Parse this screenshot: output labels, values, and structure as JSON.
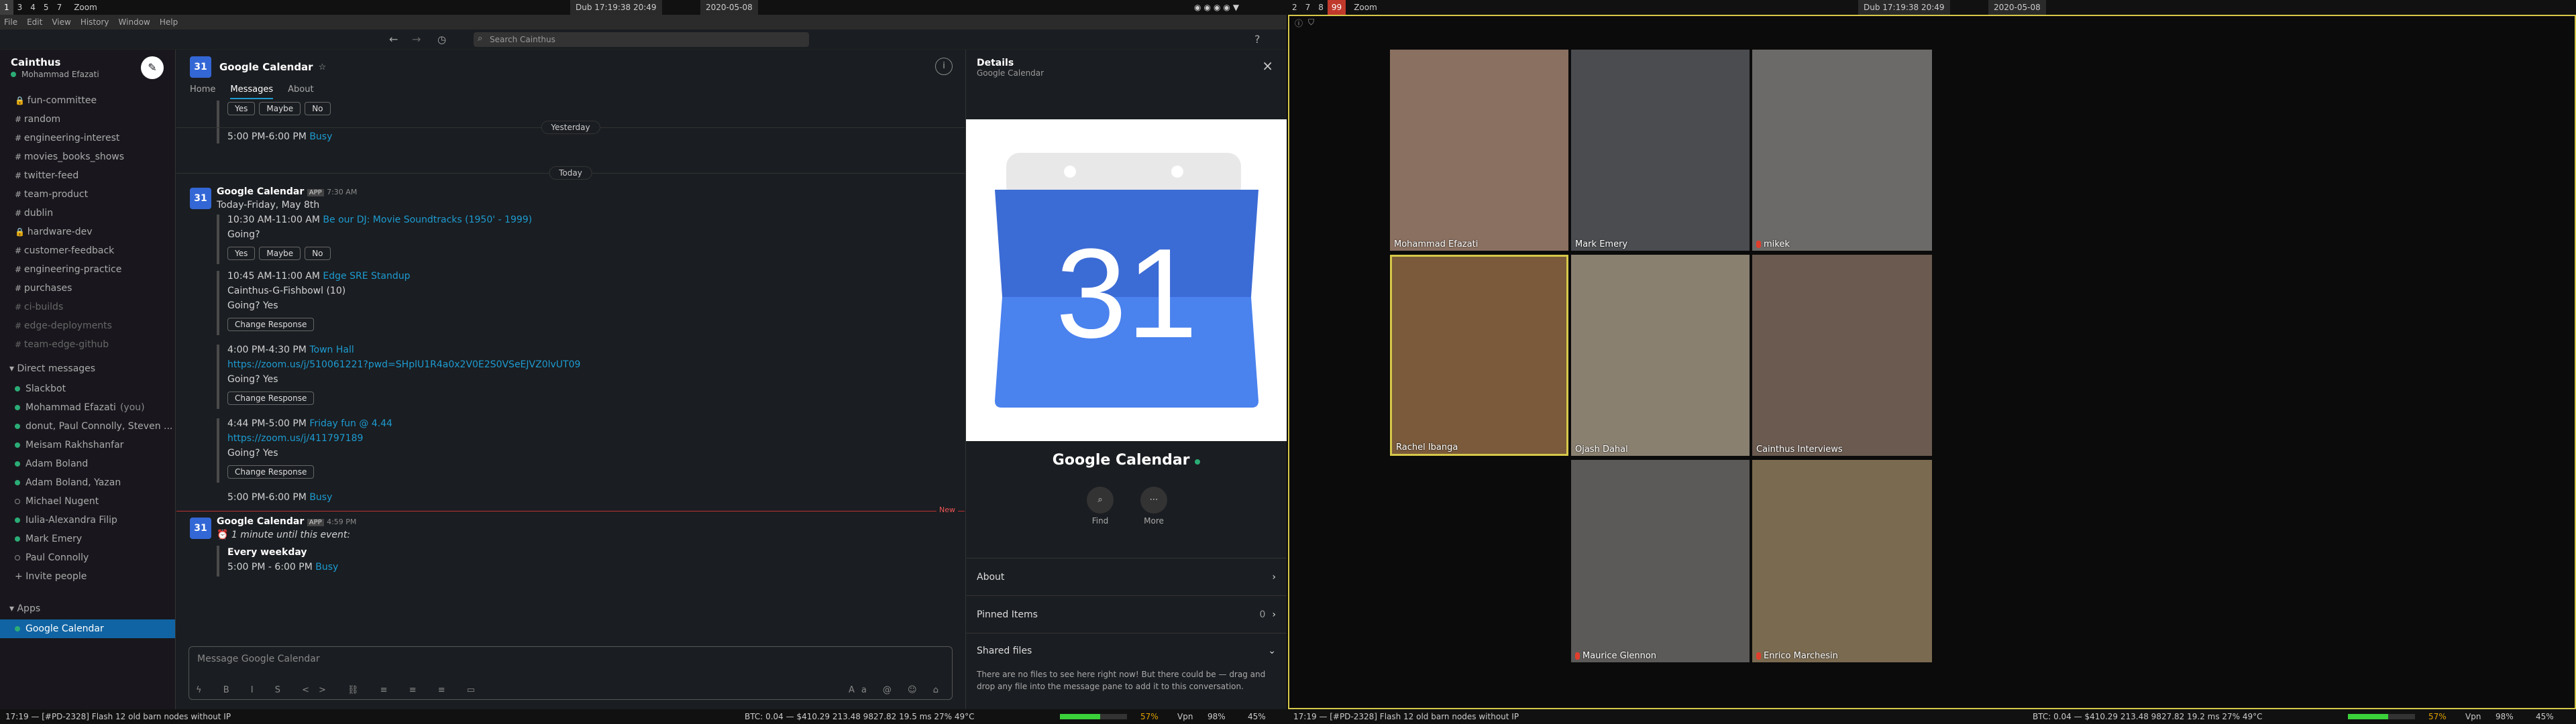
{
  "topbar": {
    "workspaces_left": [
      "1",
      "3",
      "4",
      "5",
      "7"
    ],
    "app_left": "Zoom",
    "clock_left": "Dub 17:19:38 20:49",
    "date_left": "2020-05-08",
    "workspaces_right": [
      "2",
      "7",
      "8",
      "99"
    ],
    "app_right": "Zoom",
    "clock_right": "Dub 17:19:38 20:49",
    "date_right": "2020-05-08"
  },
  "bottombar": {
    "left_task": "17:19 — [#PD-2328] Flash 12 old barn nodes without IP",
    "right_task": "17:19 — [#PD-2328] Flash 12 old barn nodes without IP",
    "stats_left": "BTC: 0.04 — $410.29   213.48   9827.82   19.5 ms   27%   49°C",
    "stats_right": "BTC: 0.04 — $410.29   213.48   9827.82   19.2 ms   27%   49°C",
    "battery": "57%",
    "vpn": "Vpn",
    "vol": "98%",
    "bright": "45%"
  },
  "menubar": [
    "File",
    "Edit",
    "View",
    "History",
    "Window",
    "Help"
  ],
  "search": {
    "placeholder": "Search Cainthus"
  },
  "sidebar": {
    "workspace": "Cainthus",
    "user": "Mohammad Efazati",
    "channels": [
      {
        "label": "fun-committee",
        "muted": false,
        "lock": true
      },
      {
        "label": "random",
        "muted": false,
        "lock": false
      },
      {
        "label": "engineering-interest",
        "muted": false,
        "lock": false
      },
      {
        "label": "movies_books_shows",
        "muted": false,
        "lock": false
      },
      {
        "label": "twitter-feed",
        "muted": false,
        "lock": false
      },
      {
        "label": "team-product",
        "muted": false,
        "lock": false
      },
      {
        "label": "dublin",
        "muted": false,
        "lock": false
      },
      {
        "label": "hardware-dev",
        "muted": false,
        "lock": true
      },
      {
        "label": "customer-feedback",
        "muted": false,
        "lock": false
      },
      {
        "label": "engineering-practice",
        "muted": false,
        "lock": false
      },
      {
        "label": "purchases",
        "muted": false,
        "lock": false
      },
      {
        "label": "ci-builds",
        "muted": true,
        "lock": false
      },
      {
        "label": "edge-deployments",
        "muted": true,
        "lock": false
      },
      {
        "label": "team-edge-github",
        "muted": true,
        "lock": false
      }
    ],
    "dm_header": "Direct messages",
    "dms": [
      {
        "label": "Slackbot",
        "online": true,
        "suffix": ""
      },
      {
        "label": "Mohammad Efazati",
        "online": true,
        "suffix": "(you)"
      },
      {
        "label": "donut, Paul Connolly, Steven ...",
        "online": true,
        "suffix": ""
      },
      {
        "label": "Meisam Rakhshanfar",
        "online": true,
        "suffix": ""
      },
      {
        "label": "Adam Boland",
        "online": true,
        "suffix": ""
      },
      {
        "label": "Adam Boland, Yazan",
        "online": true,
        "suffix": ""
      },
      {
        "label": "Michael Nugent",
        "online": false,
        "suffix": ""
      },
      {
        "label": "Iulia-Alexandra Filip",
        "online": true,
        "suffix": ""
      },
      {
        "label": "Mark Emery",
        "online": true,
        "suffix": ""
      },
      {
        "label": "Paul Connolly",
        "online": false,
        "suffix": ""
      }
    ],
    "invite": "Invite people",
    "apps_header": "Apps",
    "app_selected": "Google Calendar"
  },
  "channel": {
    "icon_text": "31",
    "title": "Google Calendar",
    "tabs": [
      "Home",
      "Messages",
      "About"
    ],
    "yesterday": "Yesterday",
    "today": "Today",
    "new_label": "New",
    "sender": "Google Calendar",
    "app_badge": "APP",
    "time1": "7:30 AM",
    "time2": "4:59 PM",
    "top_buttons": [
      "Yes",
      "Maybe",
      "No"
    ],
    "top_event": "5:00 PM-6:00 PM",
    "top_event_link": "Busy",
    "day_header": "Today-Friday, May 8th",
    "e1_time": "10:30 AM-11:00 AM",
    "e1_title": "Be our DJ: Movie Soundtracks (1950' - 1999)",
    "going_q": "Going?",
    "e2_time": "10:45 AM-11:00 AM",
    "e2_title": "Edge SRE Standup",
    "e2_room": "Cainthus-G-Fishbowl (10)",
    "going_yes": "Going? Yes",
    "change": "Change Response",
    "e3_time": "4:00 PM-4:30 PM",
    "e3_title": "Town Hall",
    "e3_link": "https://zoom.us/j/510061221?pwd=SHplU1R4a0x2V0E2S0VSeEJVZ0lvUT09",
    "e4_time": "4:44 PM-5:00 PM",
    "e4_title": "Friday fun @ 4.44",
    "e4_link": "https://zoom.us/j/411797189",
    "e5_time": "5:00 PM-6:00 PM",
    "e5_link": "Busy",
    "reminder": "1 minute until this event:",
    "weekday": "Every weekday",
    "weekday_time": "5:00 PM - 6:00 PM",
    "weekday_link": "Busy",
    "composer_placeholder": "Message Google Calendar"
  },
  "details": {
    "title": "Details",
    "subtitle": "Google Calendar",
    "cal_number": "31",
    "name": "Google Calendar",
    "find": "Find",
    "more": "More",
    "about": "About",
    "pinned": "Pinned Items",
    "pinned_count": "0",
    "shared": "Shared files",
    "shared_text": "There are no files to see here right now! But there could be — drag and drop any file into the message pane to add it to this conversation."
  },
  "zoom": {
    "participants": [
      "Mohammad Efazati",
      "Mark Emery",
      "mikek",
      "Rachel Ibanga",
      "Ojash Dahal",
      "Cainthus Interviews",
      "Maurice Glennon",
      "Enrico Marchesin"
    ],
    "tile_colors": [
      "#8a7060",
      "#4a4c50",
      "#6c6a68",
      "#7a5a3a",
      "#8a8070",
      "#6a5a50",
      "#5c5a58",
      "#7a6a50"
    ]
  },
  "colors": {
    "accent": "#1164a3",
    "link": "#1d9bd1",
    "online": "#2bac76",
    "zoom_active": "#d6c84a"
  }
}
